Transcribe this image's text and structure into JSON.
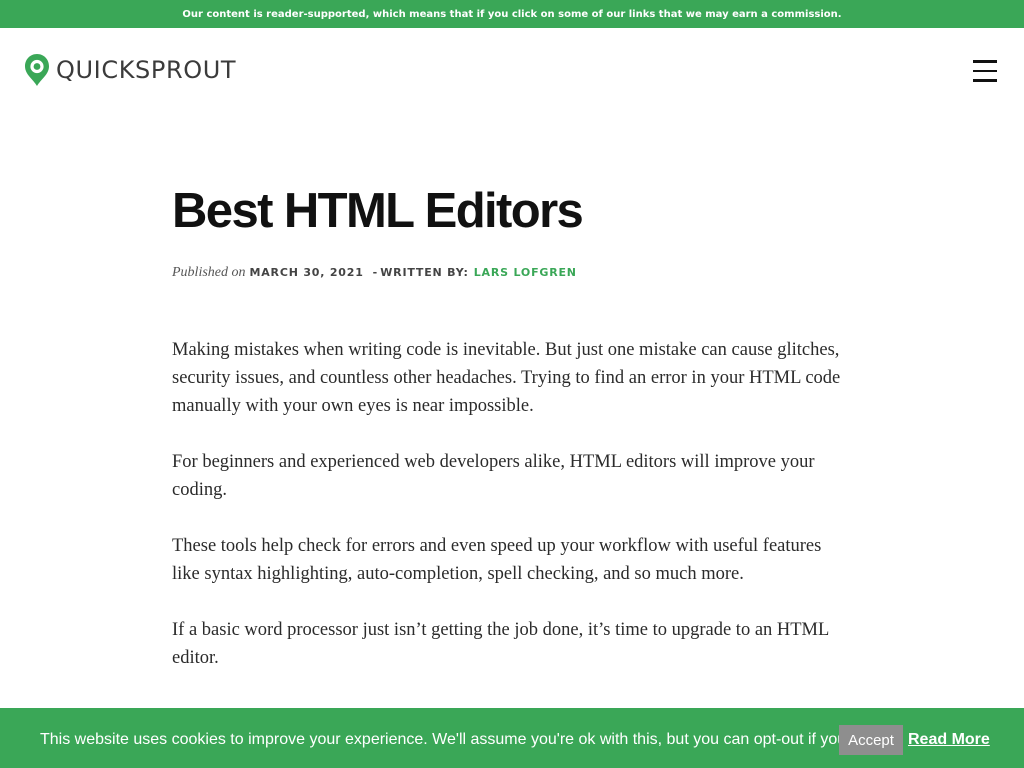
{
  "top_banner": {
    "text": "Our content is reader-supported, which means that if you click on some of our links that we may earn a commission."
  },
  "header": {
    "logo_text": "QUICKSPROUT",
    "logo_icon": "quicksprout-logo-icon",
    "menu_icon": "hamburger-menu-icon"
  },
  "article": {
    "title": "Best HTML Editors",
    "meta": {
      "published_label": "Published on",
      "date": "MARCH 30, 2021",
      "separator": "-",
      "written_by_label": "WRITTEN BY:",
      "author": "LARS LOFGREN"
    },
    "paragraphs": [
      "Making mistakes when writing code is inevitable. But just one mistake can cause glitches, security issues, and countless other headaches. Trying to find an error in your HTML code manually with your own eyes is near impossible.",
      "For beginners and experienced web developers alike, HTML editors will improve your coding.",
      "These tools help check for errors and even speed up your workflow with useful features like syntax highlighting, auto-completion, spell checking, and so much more.",
      "If a basic word processor just isn’t getting the job done, it’s time to upgrade to an HTML editor."
    ]
  },
  "cookie_bar": {
    "text": "This website uses cookies to improve your experience. We'll assume you're ok with this, but you can opt-out if you wish.",
    "accept_label": "Accept",
    "read_more_label": "Read More"
  },
  "colors": {
    "brand_green": "#3aa757",
    "title_text": "#111111",
    "accept_button": "#8e8e8e"
  }
}
